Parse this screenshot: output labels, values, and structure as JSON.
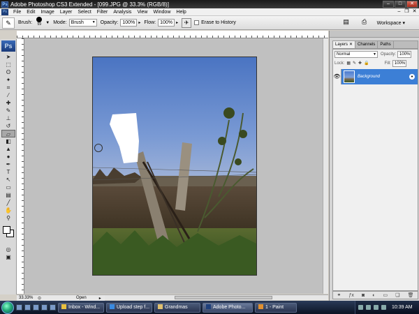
{
  "window": {
    "title": "Adobe Photoshop CS3 Extended - [099.JPG @ 33.3% (RGB/8)]",
    "app_icon": "Ps"
  },
  "menu": [
    "File",
    "Edit",
    "Image",
    "Layer",
    "Select",
    "Filter",
    "Analysis",
    "View",
    "Window",
    "Help"
  ],
  "options": {
    "brush_label": "Brush:",
    "brush_size": "59",
    "mode_label": "Mode:",
    "mode_value": "Brush",
    "opacity_label": "Opacity:",
    "opacity_value": "100%",
    "flow_label": "Flow:",
    "flow_value": "100%",
    "erase_to_history": "Erase to History",
    "workspace": "Workspace"
  },
  "toolbox": {
    "logo": "Ps"
  },
  "status": {
    "zoom": "33.33%",
    "doc_info": "Open"
  },
  "panels": {
    "tabs": [
      "Layers",
      "Channels",
      "Paths"
    ],
    "blend_mode": "Normal",
    "opacity_label": "Opacity:",
    "opacity_value": "100%",
    "lock_label": "Lock:",
    "fill_label": "Fill:",
    "fill_value": "100%",
    "layer_name": "Background"
  },
  "taskbar": {
    "tasks": [
      {
        "label": "Inbox - Wind...",
        "icon_color": "#e8c040"
      },
      {
        "label": "Upload step f...",
        "icon_color": "#3a8ae0"
      },
      {
        "label": "Grandmas",
        "icon_color": "#e0c070"
      },
      {
        "label": "Adobe Photo...",
        "icon_color": "#1e3f7a"
      },
      {
        "label": "1 - Paint",
        "icon_color": "#e09030"
      }
    ],
    "clock": "10:39 AM"
  },
  "colors": {
    "accent": "#3c7fd6",
    "sky": "#5a85cc",
    "canvas_bg": "#c0c0c0"
  }
}
